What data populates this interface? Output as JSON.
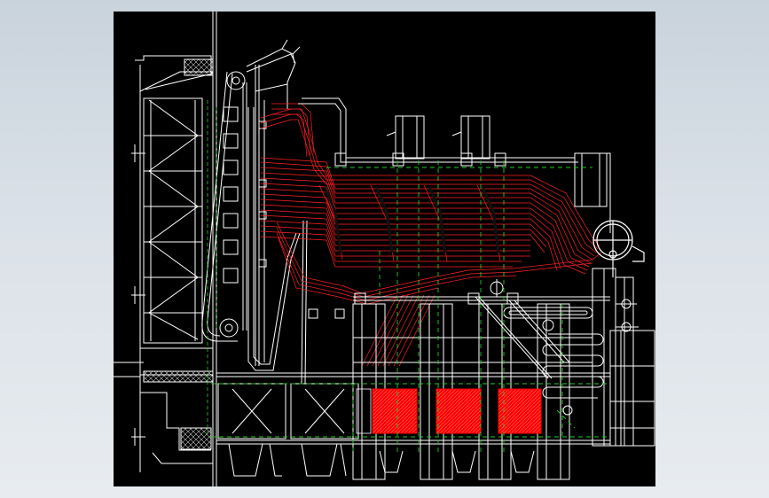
{
  "viewer": {
    "background_color": "#d3dbe3"
  },
  "drawing": {
    "background_color": "#000000",
    "colors": {
      "outline": "#ffffff",
      "tube_bank": "#ff2020",
      "centerline": "#22cc22",
      "hatch_fill": "#ff0000"
    },
    "icons": [
      "boiler-furnace-outline",
      "chain-grate-drum",
      "convection-tube-bank",
      "steam-drum",
      "economizer-coil",
      "ash-hopper",
      "hatched-air-chambers"
    ]
  }
}
